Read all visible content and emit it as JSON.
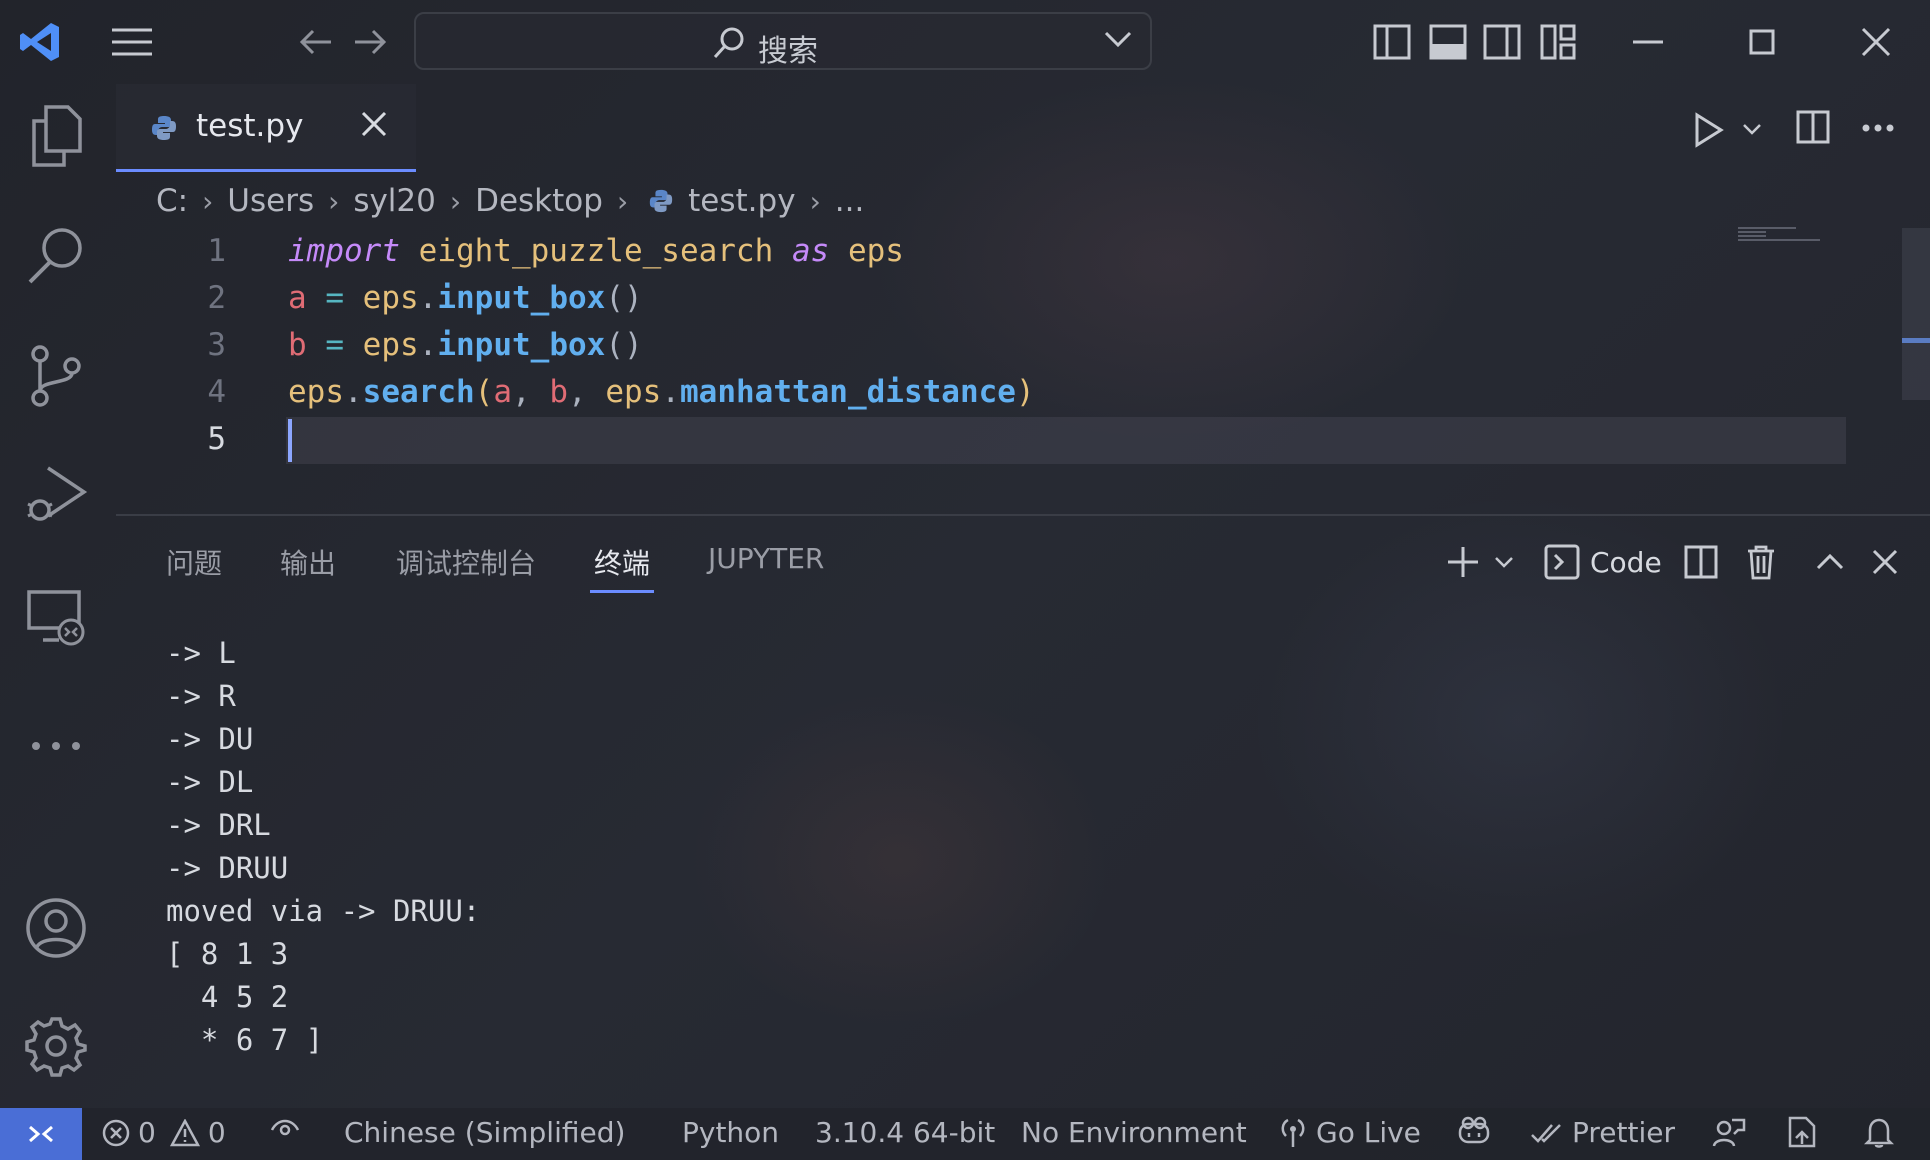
{
  "titlebar": {
    "search_label": "搜索"
  },
  "tab": {
    "filename": "test.py"
  },
  "breadcrumb": [
    "C:",
    "Users",
    "syl20",
    "Desktop",
    "test.py",
    "..."
  ],
  "editor": {
    "line_numbers": [
      "1",
      "2",
      "3",
      "4",
      "5"
    ],
    "active_line": 5,
    "lines": [
      [
        {
          "t": "import",
          "c": "k"
        },
        {
          "t": " ",
          "c": "p"
        },
        {
          "t": "eight_puzzle_search",
          "c": "m"
        },
        {
          "t": " ",
          "c": "p"
        },
        {
          "t": "as",
          "c": "k"
        },
        {
          "t": " ",
          "c": "p"
        },
        {
          "t": "eps",
          "c": "m"
        }
      ],
      [
        {
          "t": "a",
          "c": "v"
        },
        {
          "t": " = ",
          "c": "o"
        },
        {
          "t": "eps",
          "c": "m"
        },
        {
          "t": ".",
          "c": "p"
        },
        {
          "t": "input_box",
          "c": "f"
        },
        {
          "t": "()",
          "c": "p"
        }
      ],
      [
        {
          "t": "b",
          "c": "v"
        },
        {
          "t": " = ",
          "c": "o"
        },
        {
          "t": "eps",
          "c": "m"
        },
        {
          "t": ".",
          "c": "p"
        },
        {
          "t": "input_box",
          "c": "f"
        },
        {
          "t": "()",
          "c": "p"
        }
      ],
      [
        {
          "t": "eps",
          "c": "m"
        },
        {
          "t": ".",
          "c": "p"
        },
        {
          "t": "search",
          "c": "f"
        },
        {
          "t": "(",
          "c": "m"
        },
        {
          "t": "a",
          "c": "v"
        },
        {
          "t": ", ",
          "c": "p"
        },
        {
          "t": "b",
          "c": "v"
        },
        {
          "t": ", ",
          "c": "p"
        },
        {
          "t": "eps",
          "c": "m"
        },
        {
          "t": ".",
          "c": "p"
        },
        {
          "t": "manhattan_distance",
          "c": "f"
        },
        {
          "t": ")",
          "c": "m"
        }
      ],
      []
    ]
  },
  "panel": {
    "tabs": [
      "问题",
      "输出",
      "调试控制台",
      "终端",
      "JUPYTER"
    ],
    "active_tab": "终端",
    "terminal_name": "Code",
    "terminal_lines": [
      "-> L",
      "-> R",
      "-> DU",
      "-> DL",
      "-> DRL",
      "-> DRUU",
      "moved via -> DRUU:",
      "[ 8 1 3",
      "  4 5 2",
      "  * 6 7 ]"
    ]
  },
  "statusbar": {
    "errors": "0",
    "warnings": "0",
    "language_pack": "Chinese (Simplified)",
    "language": "Python",
    "interpreter": "3.10.4 64-bit",
    "environment": "No Environment",
    "go_live": "Go Live",
    "prettier": "Prettier"
  },
  "colors": {
    "accent": "#6b8cff",
    "remote": "#4a6ed6",
    "keyword": "#c58af9",
    "function": "#61afef",
    "variable": "#e06c75",
    "module": "#e5c07b"
  }
}
